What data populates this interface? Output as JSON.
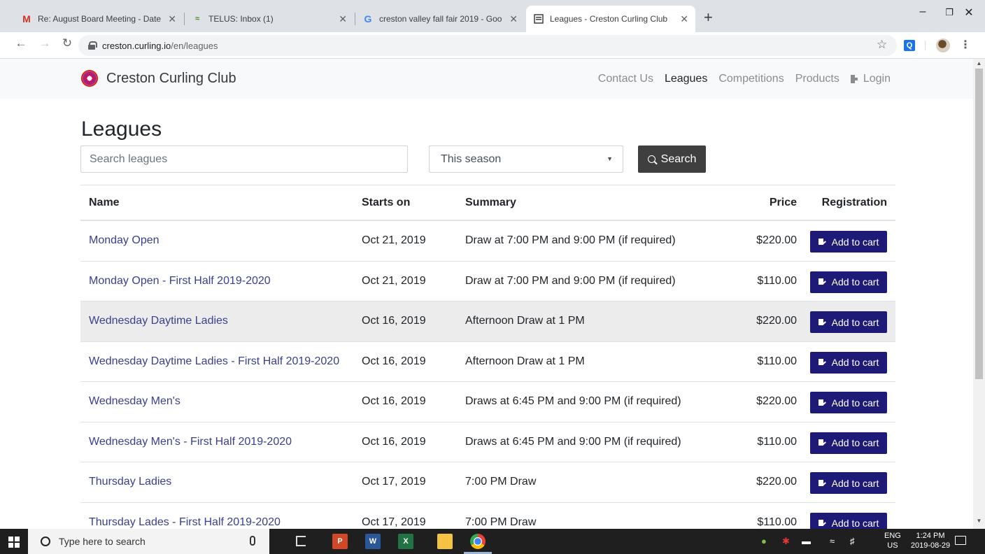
{
  "browser": {
    "tabs": [
      {
        "title": "Re: August Board Meeting - Date",
        "icon": "gmail-icon",
        "close": "✕"
      },
      {
        "title": "TELUS: Inbox (1)",
        "icon": "telus-icon",
        "close": "✕"
      },
      {
        "title": "creston valley fall fair 2019 - Goo",
        "icon": "google-icon",
        "close": "✕"
      },
      {
        "title": "Leagues - Creston Curling Club",
        "icon": "page-icon",
        "close": "✕",
        "active": true
      }
    ],
    "new_tab": "+",
    "url_host": "creston.curling.io",
    "url_path": "/en/leagues",
    "extension_label": "Q"
  },
  "site": {
    "brand": "Creston Curling Club",
    "nav": [
      {
        "label": "Contact Us",
        "active": false
      },
      {
        "label": "Leagues",
        "active": true
      },
      {
        "label": "Competitions",
        "active": false
      },
      {
        "label": "Products",
        "active": false
      }
    ],
    "login": "Login"
  },
  "page": {
    "title": "Leagues",
    "search_placeholder": "Search leagues",
    "season_value": "This season",
    "search_button": "Search"
  },
  "table": {
    "headers": {
      "name": "Name",
      "starts_on": "Starts on",
      "summary": "Summary",
      "price": "Price",
      "registration": "Registration"
    },
    "rows": [
      {
        "name": "Monday Open",
        "starts_on": "Oct 21, 2019",
        "summary": "Draw at 7:00 PM and 9:00 PM (if required)",
        "price": "$220.00",
        "action": "Add to cart"
      },
      {
        "name": "Monday Open - First Half 2019-2020",
        "starts_on": "Oct 21, 2019",
        "summary": "Draw at 7:00 PM and 9:00 PM (if required)",
        "price": "$110.00",
        "action": "Add to cart"
      },
      {
        "name": "Wednesday Daytime Ladies",
        "starts_on": "Oct 16, 2019",
        "summary": "Afternoon Draw at 1 PM",
        "price": "$220.00",
        "action": "Add to cart",
        "hovered": true
      },
      {
        "name": "Wednesday Daytime Ladies - First Half 2019-2020",
        "starts_on": "Oct 16, 2019",
        "summary": "Afternoon Draw at 1 PM",
        "price": "$110.00",
        "action": "Add to cart"
      },
      {
        "name": "Wednesday Men's",
        "starts_on": "Oct 16, 2019",
        "summary": "Draws at 6:45 PM and 9:00 PM (if required)",
        "price": "$220.00",
        "action": "Add to cart"
      },
      {
        "name": "Wednesday Men's - First Half 2019-2020",
        "starts_on": "Oct 16, 2019",
        "summary": "Draws at 6:45 PM and 9:00 PM (if required)",
        "price": "$110.00",
        "action": "Add to cart"
      },
      {
        "name": "Thursday Ladies",
        "starts_on": "Oct 17, 2019",
        "summary": "7:00 PM Draw",
        "price": "$220.00",
        "action": "Add to cart"
      },
      {
        "name": "Thursday Lades - First Half 2019-2020",
        "starts_on": "Oct 17, 2019",
        "summary": "7:00 PM Draw",
        "price": "$110.00",
        "action": "Add to cart"
      }
    ]
  },
  "taskbar": {
    "search_placeholder": "Type here to search",
    "apps": [
      {
        "name": "powerpoint-icon",
        "label": "P",
        "color": "#d24726"
      },
      {
        "name": "word-icon",
        "label": "W",
        "color": "#2b579a"
      },
      {
        "name": "excel-icon",
        "label": "X",
        "color": "#217346"
      },
      {
        "name": "file-explorer-icon",
        "label": "",
        "color": "#f5c342"
      }
    ],
    "lang_top": "ENG",
    "lang_bottom": "US",
    "time": "1:24 PM",
    "date": "2019-08-29"
  },
  "colors": {
    "link": "#3a3f8f",
    "cart_button": "#1e1a78",
    "search_button": "#3f3f3f",
    "hover_row": "#ececec"
  }
}
